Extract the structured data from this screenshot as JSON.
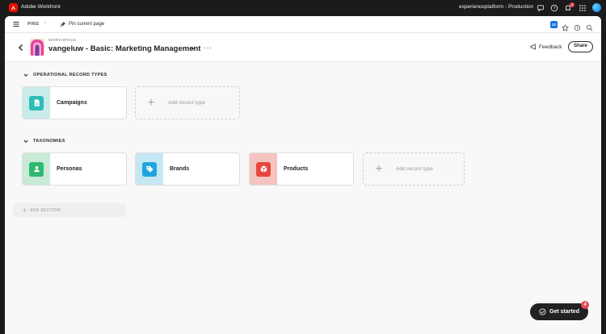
{
  "app": {
    "name": "Adobe Workfront",
    "environment": "experienceplatform - Production",
    "notification_count": "1"
  },
  "pinbar": {
    "pins_label": "PINS",
    "pin_current_label": "Pin current page",
    "calendar_badge": "22"
  },
  "workspace": {
    "kicker": "WORKSPACE",
    "title": "vangeluw - Basic: Marketing Management",
    "feedback_label": "Feedback",
    "share_label": "Share"
  },
  "sections": [
    {
      "title": "OPERATIONAL RECORD TYPES",
      "cards": [
        {
          "label": "Campaigns",
          "color": "#2fbdb8",
          "bg": "#c9ecea",
          "icon": "document-icon"
        }
      ],
      "add_label": "Add record type"
    },
    {
      "title": "TAXONOMIES",
      "cards": [
        {
          "label": "Personas",
          "color": "#2fb870",
          "bg": "#c8ead6",
          "icon": "person-icon"
        },
        {
          "label": "Brands",
          "color": "#1ea6dc",
          "bg": "#c5e7f4",
          "icon": "tag-icon"
        },
        {
          "label": "Products",
          "color": "#e8453c",
          "bg": "#f6c4c0",
          "icon": "box-icon"
        }
      ],
      "add_label": "Add record type"
    }
  ],
  "add_section_label": "ADD SECTION",
  "get_started": {
    "label": "Get started",
    "badge": "4"
  }
}
